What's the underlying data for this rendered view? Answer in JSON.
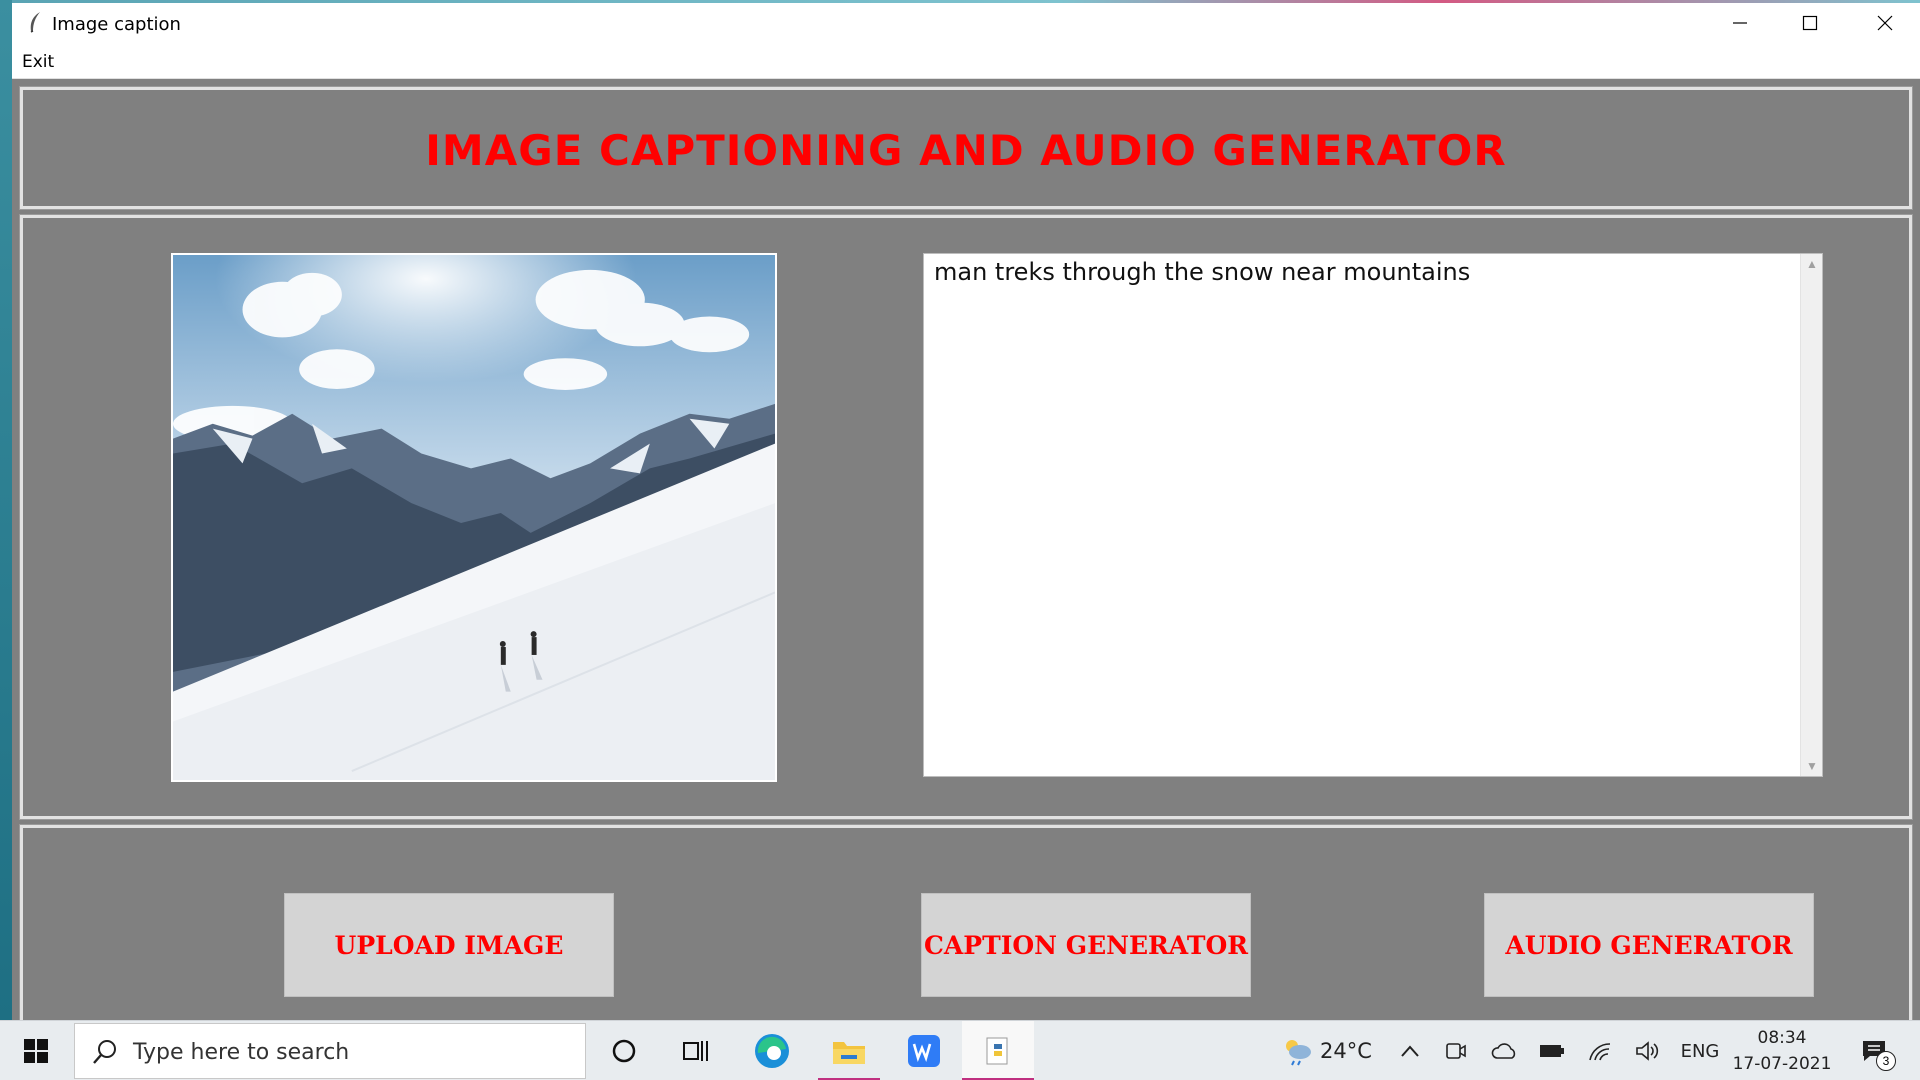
{
  "window": {
    "title": "Image caption",
    "controls": {
      "minimize": "minimize-icon",
      "maximize": "maximize-icon",
      "close": "close-icon"
    }
  },
  "menu": {
    "exit_label": "Exit"
  },
  "header": {
    "title": "IMAGE CAPTIONING AND AUDIO GENERATOR",
    "title_color": "#ff0000"
  },
  "main": {
    "image_description_icon": "uploaded-image",
    "caption_text": "man treks through the snow near mountains"
  },
  "buttons": {
    "upload_label": "UPLOAD IMAGE",
    "caption_label": "CAPTION GENERATOR",
    "audio_label": "AUDIO GENERATOR"
  },
  "colors": {
    "panel_bg": "#808080",
    "button_bg": "#d4d4d4",
    "accent_text": "#ff0000"
  },
  "taskbar": {
    "search_placeholder": "Type here to search",
    "weather_temp": "24°C",
    "language": "ENG",
    "time": "08:34",
    "date": "17-07-2021",
    "notification_count": "3"
  }
}
